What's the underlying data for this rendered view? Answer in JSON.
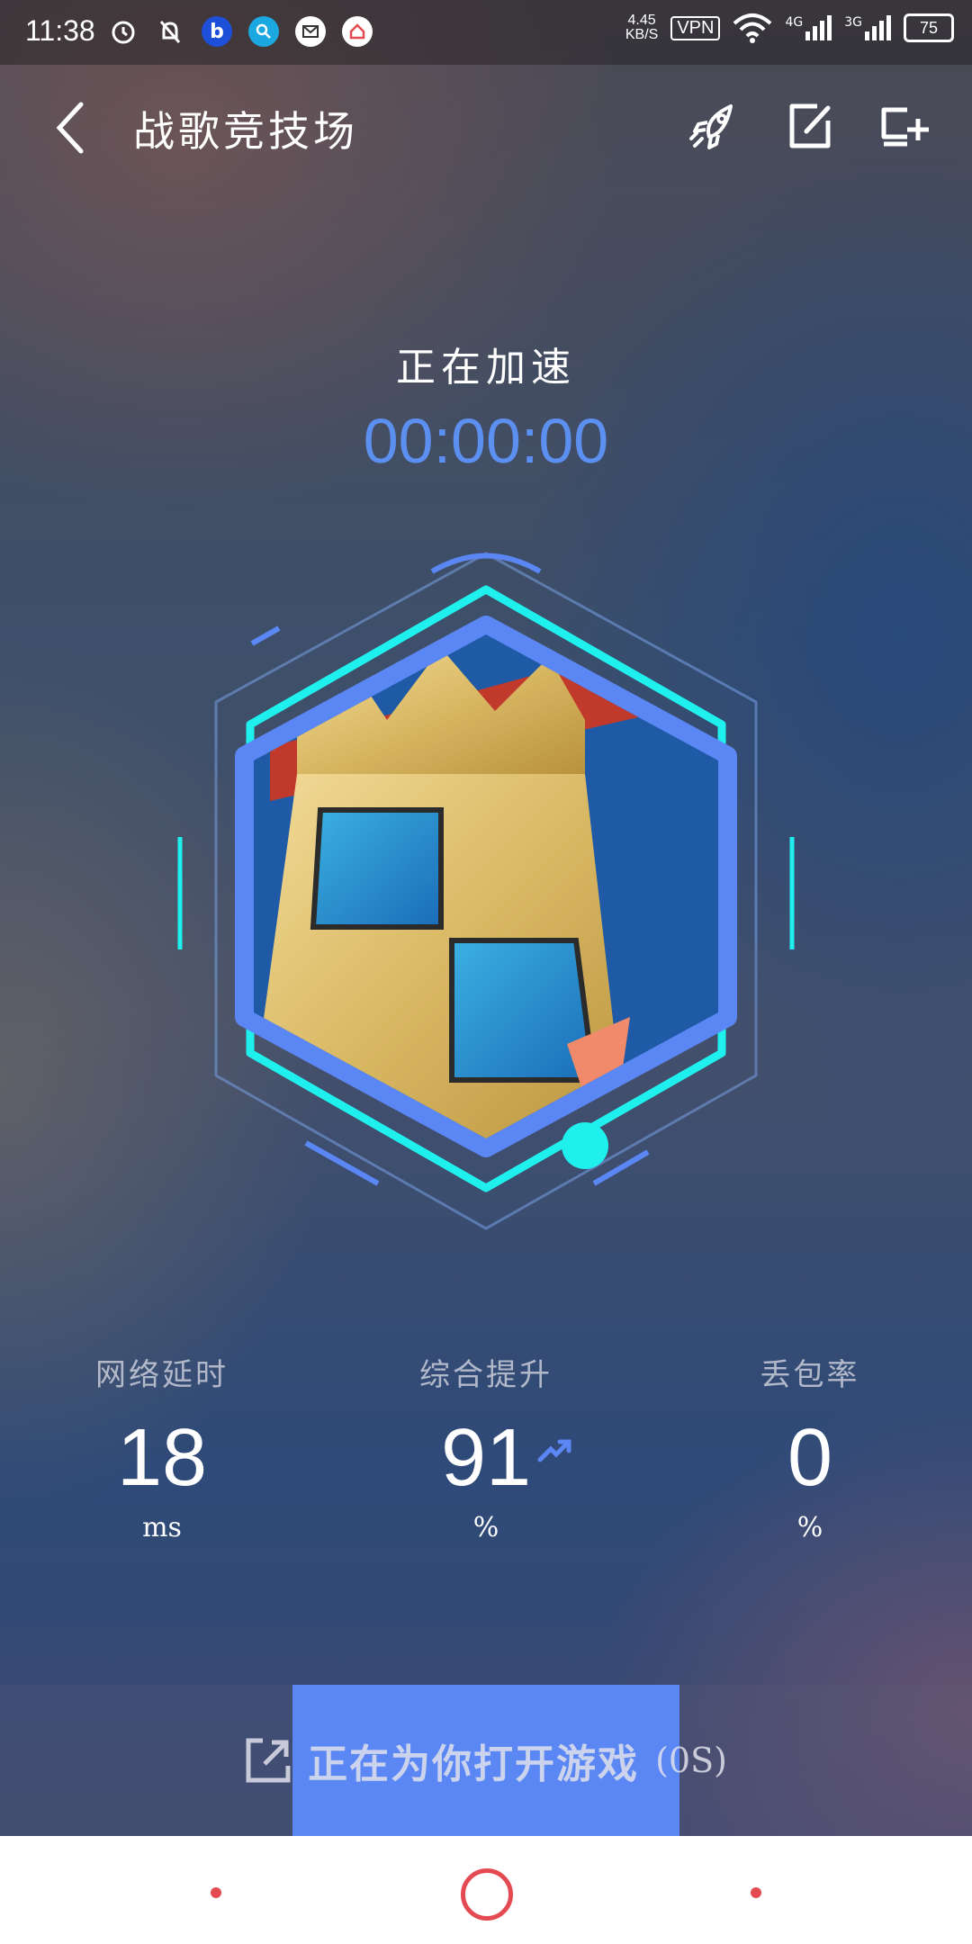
{
  "status_bar": {
    "time": "11:38",
    "net_speed_value": "4.45",
    "net_speed_unit": "KB/S",
    "vpn": "VPN",
    "network_4g": "4G",
    "network_3g": "3G",
    "battery": "75"
  },
  "header": {
    "title": "战歌竞技场"
  },
  "accel": {
    "status": "正在加速",
    "elapsed": "00:00:00"
  },
  "stats": [
    {
      "label": "网络延时",
      "value": "18",
      "unit": "ms"
    },
    {
      "label": "综合提升",
      "value": "91",
      "unit": "%"
    },
    {
      "label": "丢包率",
      "value": "0",
      "unit": "%"
    }
  ],
  "bottom": {
    "open_label": "正在为你打开游戏",
    "countdown": "(0S)",
    "progress_fraction": 0.4
  },
  "colors": {
    "accent_blue": "#5b87f5",
    "ring_cyan": "#1ff0ee",
    "nav_red": "#e44a52"
  }
}
